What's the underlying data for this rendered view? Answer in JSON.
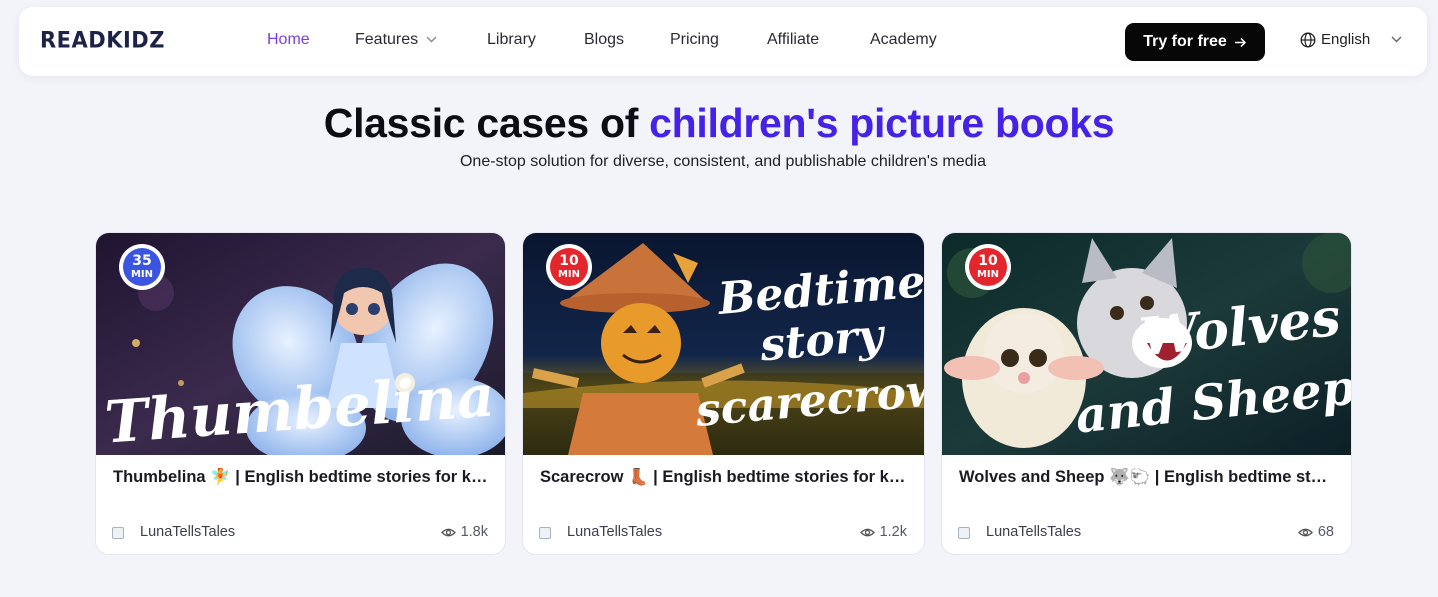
{
  "nav": {
    "logo": "READKIDZ",
    "links": [
      {
        "label": "Home",
        "active": true
      },
      {
        "label": "Features",
        "dropdown": true
      },
      {
        "label": "Library"
      },
      {
        "label": "Blogs"
      },
      {
        "label": "Pricing"
      },
      {
        "label": "Affiliate"
      },
      {
        "label": "Academy"
      }
    ],
    "cta_label": "Try for free",
    "language": "English"
  },
  "hero": {
    "title_plain": "Classic cases of",
    "title_highlight": "children's picture books",
    "subtitle": "One-stop solution for diverse, consistent, and publishable children's media"
  },
  "cards": [
    {
      "badge_number": "35",
      "badge_unit": "MIN",
      "overlay_title": [
        "Thumbelina"
      ],
      "title": "Thumbelina 🧚 | English bedtime stories for kids",
      "author": "LunaTellsTales",
      "views": "1.8k"
    },
    {
      "badge_number": "10",
      "badge_unit": "MIN",
      "overlay_title": [
        "Bedtime",
        "story",
        "scarecrow"
      ],
      "title": "Scarecrow 👢 | English bedtime stories for kids",
      "author": "LunaTellsTales",
      "views": "1.2k"
    },
    {
      "badge_number": "10",
      "badge_unit": "MIN",
      "overlay_title": [
        "Wolves",
        "and Sheep"
      ],
      "title": "Wolves and Sheep 🐺🐑 | English bedtime stories for kids",
      "author": "LunaTellsTales",
      "views": "68"
    }
  ],
  "colors": {
    "accent": "#7a3ee8",
    "highlight": "#4622e6",
    "badge_blue": "#3c55e0",
    "badge_red": "#e2262b"
  },
  "icons": {
    "dropdown": "chevron-down-icon",
    "cta_arrow": "arrow-right-icon",
    "language": "globe-icon",
    "views": "eye-icon"
  }
}
